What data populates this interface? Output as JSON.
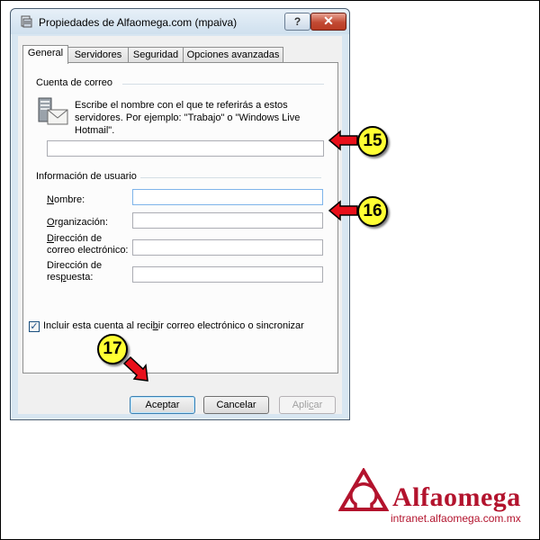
{
  "window": {
    "title": "Propiedades de Alfaomega.com (mpaiva)",
    "help_label": "?",
    "close_label": "✕"
  },
  "tabs": [
    {
      "label": "General",
      "active": true
    },
    {
      "label": "Servidores",
      "active": false
    },
    {
      "label": "Seguridad",
      "active": false
    },
    {
      "label": "Opciones avanzadas",
      "active": false
    }
  ],
  "mail_account": {
    "group_label": "Cuenta de correo",
    "description": "Escribe el nombre con el que te referirás a estos servidores. Por ejemplo: \"Trabajo\" o \"Windows Live Hotmail\".",
    "account_name_value": ""
  },
  "user_info": {
    "group_label": "Información de usuario",
    "name": {
      "label_u": "N",
      "label_rest": "ombre:",
      "value": ""
    },
    "organization": {
      "label_u": "O",
      "label_rest": "rganización:",
      "value": ""
    },
    "email": {
      "label_line1_u": "D",
      "label_line1_rest": "irección de",
      "label_line2": "correo electrónico:",
      "value": ""
    },
    "reply": {
      "label_line1": "Dirección de",
      "label_line2_pre": "res",
      "label_line2_u": "p",
      "label_line2_post": "uesta:",
      "value": ""
    }
  },
  "include_check": {
    "checked": true,
    "mark": "✓",
    "label_pre": "Incluir esta cuenta al reci",
    "label_u": "b",
    "label_post": "ir correo electrónico o sincronizar"
  },
  "buttons": {
    "ok": "Aceptar",
    "cancel": "Cancelar",
    "apply_pre": "Apli",
    "apply_u": "c",
    "apply_post": "ar"
  },
  "callouts": [
    "15",
    "16",
    "17"
  ],
  "branding": {
    "name": "Alfaomega",
    "url": "intranet.alfaomega.com.mx",
    "color": "#b3132d"
  },
  "colors": {
    "arrow_red": "#e8101b",
    "badge_yellow": "#ffff33"
  }
}
